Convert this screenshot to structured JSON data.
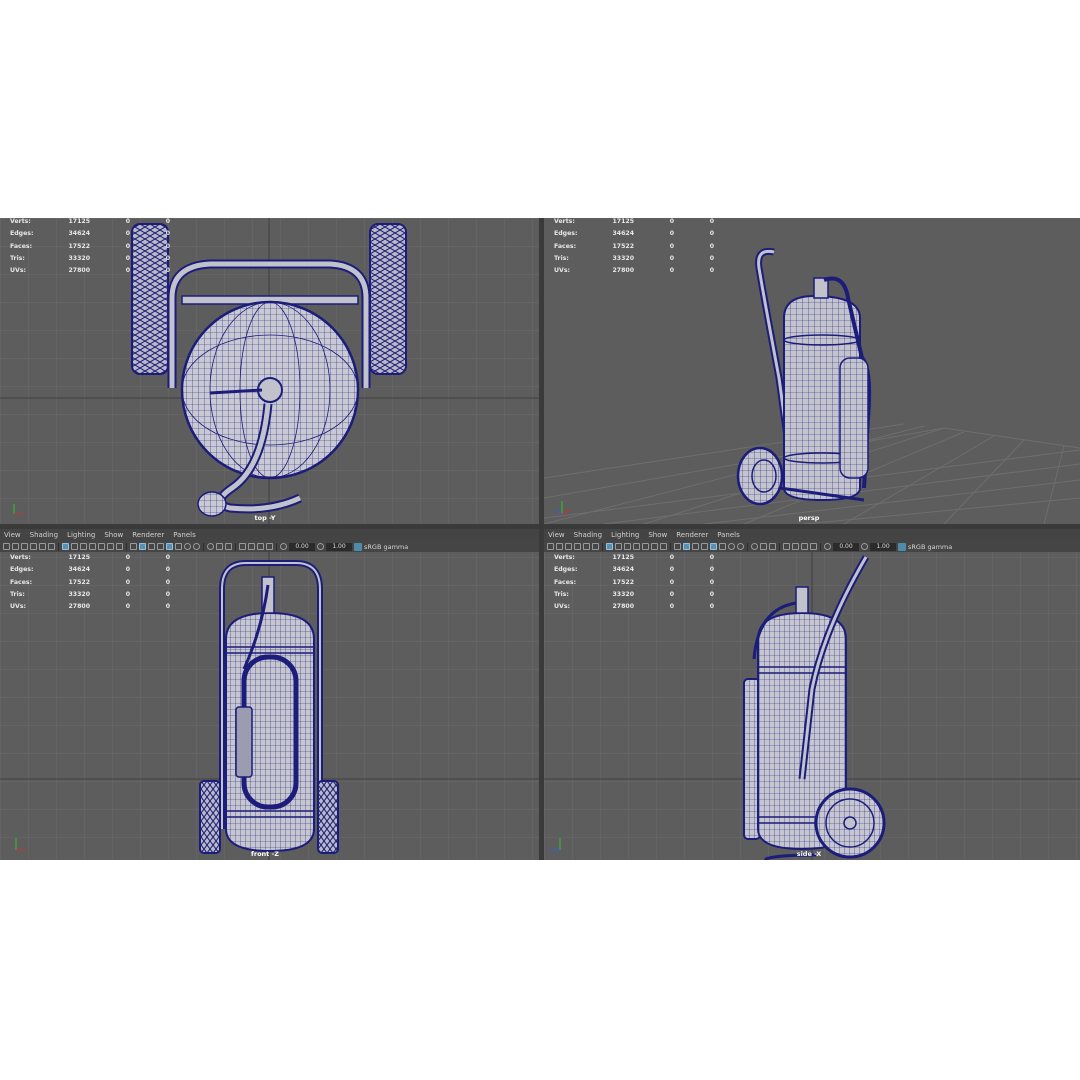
{
  "menu": [
    "View",
    "Shading",
    "Lighting",
    "Show",
    "Renderer",
    "Panels"
  ],
  "toolbar": {
    "exposure": "0.00",
    "gamma": "1.00",
    "color_space": "sRGB gamma"
  },
  "stats": [
    {
      "label": "Verts:",
      "values": [
        "17125",
        "0",
        "0"
      ]
    },
    {
      "label": "Edges:",
      "values": [
        "34624",
        "0",
        "0"
      ]
    },
    {
      "label": "Faces:",
      "values": [
        "17522",
        "0",
        "0"
      ]
    },
    {
      "label": "Tris:",
      "values": [
        "33320",
        "0",
        "0"
      ]
    },
    {
      "label": "UVs:",
      "values": [
        "27800",
        "0",
        "0"
      ]
    }
  ],
  "viewports": [
    {
      "id": "top",
      "label": "top -Y"
    },
    {
      "id": "persp",
      "label": "persp"
    },
    {
      "id": "front",
      "label": "front -Z"
    },
    {
      "id": "side",
      "label": "side -X"
    }
  ],
  "colors": {
    "wire": "#1c1c7a",
    "shade": "#c2c2cc",
    "bg": "#5d5d5d",
    "grid": "#6a6a6a"
  }
}
